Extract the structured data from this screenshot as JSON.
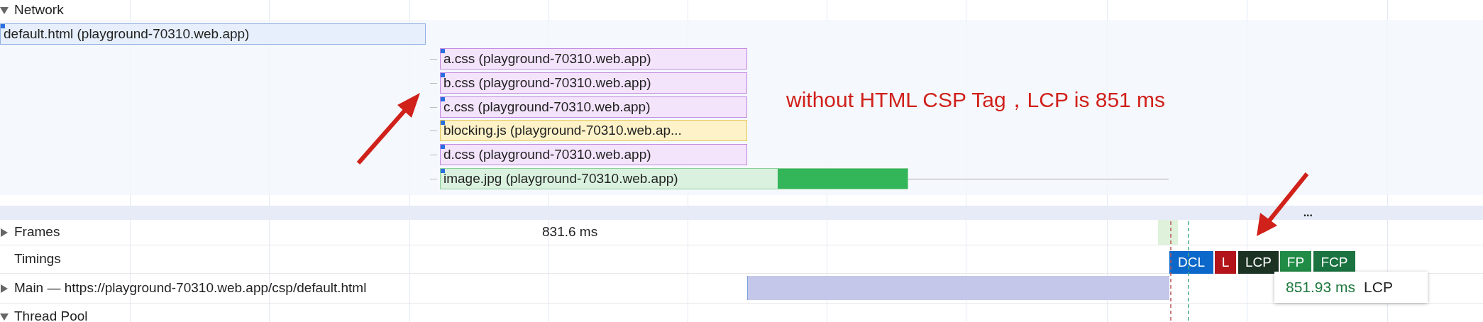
{
  "network": {
    "title": "Network",
    "expanded": true,
    "requests": [
      {
        "label": "default.html (playground-70310.web.app)",
        "kind": "html"
      },
      {
        "label": "a.css (playground-70310.web.app)",
        "kind": "css"
      },
      {
        "label": "b.css (playground-70310.web.app)",
        "kind": "css"
      },
      {
        "label": "c.css (playground-70310.web.app)",
        "kind": "css"
      },
      {
        "label": "blocking.js (playground-70310.web.ap...",
        "kind": "script"
      },
      {
        "label": "d.css (playground-70310.web.app)",
        "kind": "css"
      },
      {
        "label": "image.jpg (playground-70310.web.app)",
        "kind": "image"
      }
    ]
  },
  "annotation": "without HTML CSP Tag，LCP is 851 ms",
  "separator": "...",
  "frames": {
    "label": "Frames",
    "expanded": false,
    "duration": "831.6 ms"
  },
  "timings": {
    "label": "Timings",
    "markers": [
      {
        "label": "DCL",
        "color": "#0b67c9"
      },
      {
        "label": "L",
        "color": "#b3141a"
      },
      {
        "label": "LCP",
        "color": "#1c3324"
      },
      {
        "label": "FP",
        "color": "#218c46"
      },
      {
        "label": "FCP",
        "color": "#1a7340"
      }
    ],
    "tooltip": {
      "value": "851.93 ms",
      "name": "LCP"
    }
  },
  "main": {
    "label": "Main — https://playground-70310.web.app/csp/default.html",
    "expanded": false
  },
  "thread_pool": {
    "label": "Thread Pool",
    "expanded": true
  }
}
